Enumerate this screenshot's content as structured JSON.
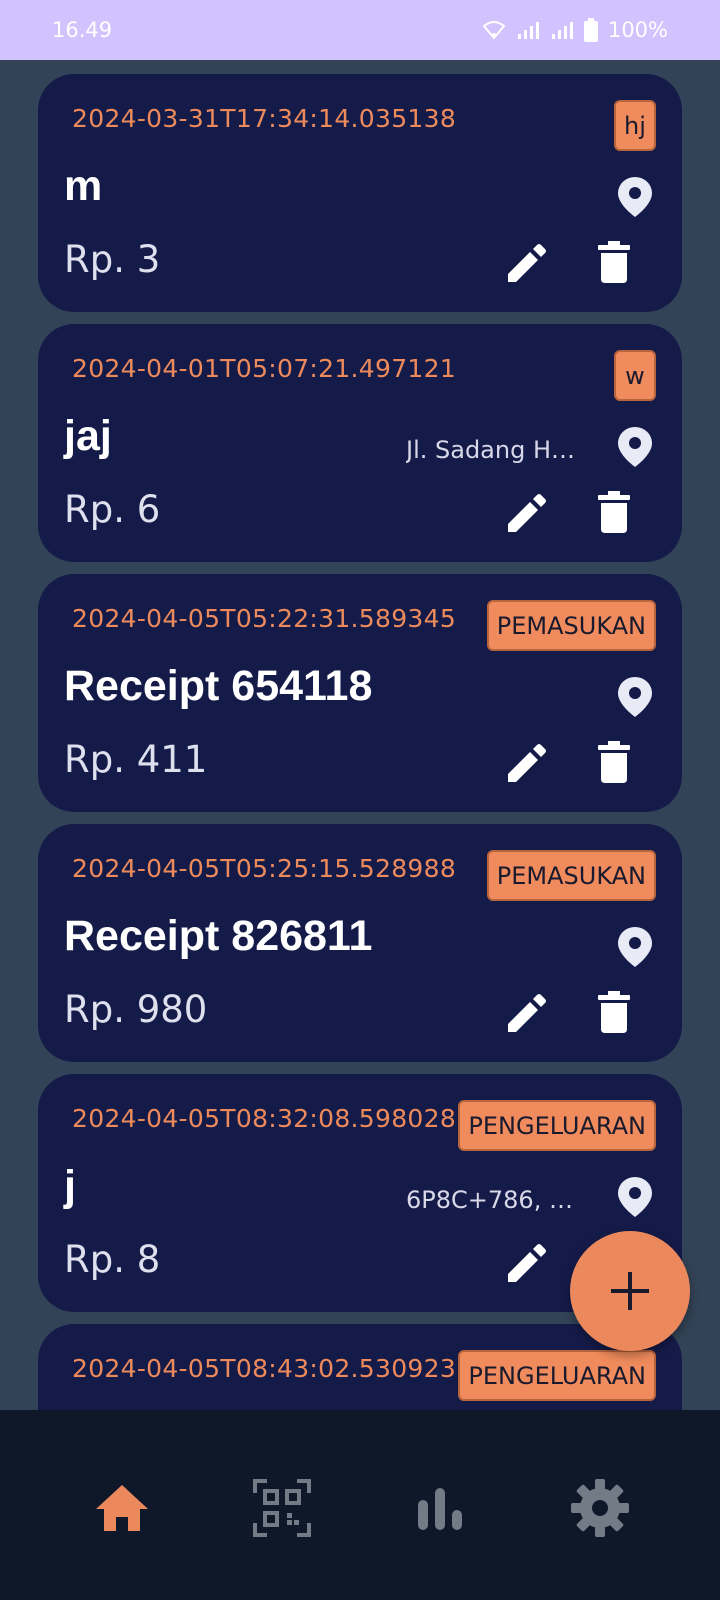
{
  "status_bar": {
    "time": "16.49",
    "battery": "100%"
  },
  "colors": {
    "accent": "#ec895c",
    "card_bg": "#151b49",
    "page_bg": "#334357",
    "nav_bg": "#0f1829"
  },
  "transactions": [
    {
      "timestamp": "2024-03-31T17:34:14.035138",
      "category": "hj",
      "title": "m",
      "location": "",
      "amount": "Rp. 3"
    },
    {
      "timestamp": "2024-04-01T05:07:21.497121",
      "category": "w",
      "title": "jaj",
      "location": "Jl. Sadang He...",
      "amount": "Rp. 6"
    },
    {
      "timestamp": "2024-04-05T05:22:31.589345",
      "category": "PEMASUKAN",
      "title": "Receipt 654118",
      "location": "",
      "amount": "Rp. 411"
    },
    {
      "timestamp": "2024-04-05T05:25:15.528988",
      "category": "PEMASUKAN",
      "title": "Receipt 826811",
      "location": "",
      "amount": "Rp. 980"
    },
    {
      "timestamp": "2024-04-05T08:32:08.598028",
      "category": "PENGELUARAN",
      "title": "j",
      "location": "6P8C+786, Ge...",
      "amount": "Rp. 8"
    },
    {
      "timestamp": "2024-04-05T08:43:02.530923",
      "category": "PENGELUARAN",
      "title": "",
      "location": "",
      "amount": ""
    }
  ],
  "icons": {
    "fab": "add-icon",
    "nav": [
      "home-icon",
      "qr-scan-icon",
      "bar-chart-icon",
      "gear-icon"
    ],
    "card_actions": [
      "location-pin-icon",
      "edit-icon",
      "delete-icon"
    ]
  },
  "bottom_nav": {
    "active_index": 0
  }
}
